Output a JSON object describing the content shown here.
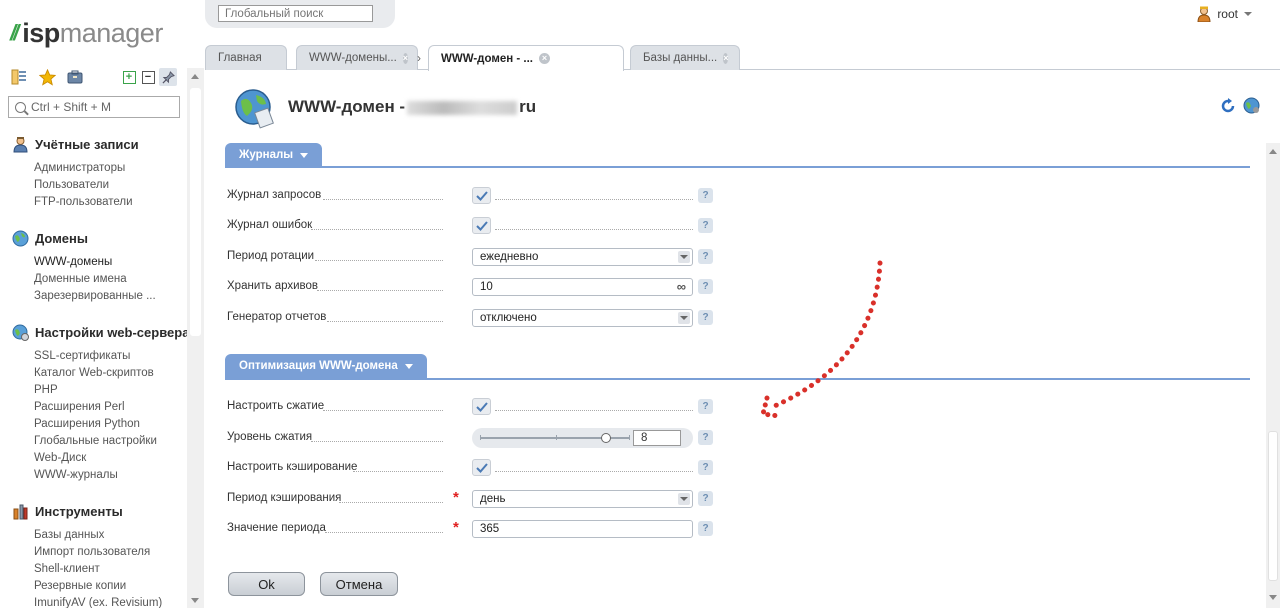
{
  "brand": {
    "slashes": "//",
    "isp": "isp",
    "manager": "manager"
  },
  "sidebar": {
    "search_placeholder": "Ctrl + Shift + M",
    "sections": [
      {
        "title": "Учётные записи",
        "icon": "users-icon",
        "items": [
          "Администраторы",
          "Пользователи",
          "FTP-пользователи"
        ]
      },
      {
        "title": "Домены",
        "icon": "globe-icon",
        "items": [
          "WWW-домены",
          "Доменные имена",
          "Зарезервированные ..."
        ]
      },
      {
        "title": "Настройки web-сервера",
        "icon": "web-server-icon",
        "items": [
          "SSL-сертификаты",
          "Каталог Web-скриптов",
          "PHP",
          "Расширения Perl",
          "Расширения Python",
          "Глобальные настройки",
          "Web-Диск",
          "WWW-журналы"
        ]
      },
      {
        "title": "Инструменты",
        "icon": "tools-icon",
        "items": [
          "Базы данных",
          "Импорт пользователя",
          "Shell-клиент",
          "Резервные копии",
          "ImunifyAV (ex. Revisium)"
        ]
      }
    ]
  },
  "header": {
    "global_search_placeholder": "Глобальный поиск",
    "user": "root"
  },
  "tabs": [
    {
      "label": "Главная"
    },
    {
      "label": "WWW-домены..."
    },
    {
      "label": "WWW-домен - ..."
    },
    {
      "label": "Базы данны..."
    }
  ],
  "page": {
    "title_prefix": "WWW-домен -",
    "title_suffix": "ru"
  },
  "sections": {
    "logs": {
      "title": "Журналы"
    },
    "optimization": {
      "title": "Оптимизация WWW-домена"
    }
  },
  "fields": {
    "request_log": {
      "label": "Журнал запросов",
      "checked": true
    },
    "error_log": {
      "label": "Журнал ошибок",
      "checked": true
    },
    "rotation_period": {
      "label": "Период ротации",
      "value": "ежедневно"
    },
    "keep_archives": {
      "label": "Хранить архивов",
      "value": "10"
    },
    "report_generator": {
      "label": "Генератор отчетов",
      "value": "отключено"
    },
    "setup_compression": {
      "label": "Настроить сжатие",
      "checked": true
    },
    "compression_level": {
      "label": "Уровень сжатия",
      "value": "8"
    },
    "setup_caching": {
      "label": "Настроить кэширование",
      "checked": true
    },
    "caching_period": {
      "label": "Период кэширования",
      "value": "день",
      "required": "*"
    },
    "period_value": {
      "label": "Значение периода",
      "value": "365",
      "required": "*"
    }
  },
  "help_glyph": "?",
  "infinity_glyph": "∞",
  "buttons": {
    "ok": "Ok",
    "cancel": "Отмена"
  },
  "colors": {
    "accent": "#7a9fd6",
    "required": "#e02020",
    "annotation_arrow": "#d9302a",
    "brand_green": "#3aa34a"
  }
}
